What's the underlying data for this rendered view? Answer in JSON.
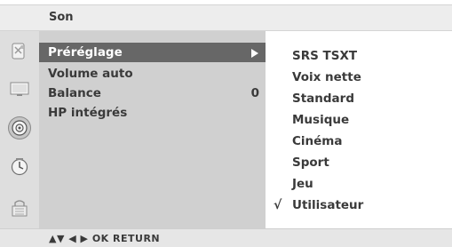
{
  "header": {
    "title": "Son"
  },
  "sidebar": {
    "icons": [
      {
        "name": "satellite-icon"
      },
      {
        "name": "monitor-icon"
      },
      {
        "name": "speaker-icon",
        "active": true
      },
      {
        "name": "clock-icon"
      },
      {
        "name": "lock-icon"
      }
    ]
  },
  "menu": {
    "items": [
      {
        "label": "Préréglage",
        "value": "",
        "selected": true
      },
      {
        "label": "Volume auto",
        "value": ""
      },
      {
        "label": "Balance",
        "value": "0"
      },
      {
        "label": "HP intégrés",
        "value": ""
      }
    ]
  },
  "options": {
    "items": [
      {
        "label": "SRS TSXT"
      },
      {
        "label": "Voix nette"
      },
      {
        "label": "Standard"
      },
      {
        "label": "Musique"
      },
      {
        "label": "Cinéma"
      },
      {
        "label": "Sport"
      },
      {
        "label": "Jeu"
      },
      {
        "label": "Utilisateur",
        "checked": true
      }
    ],
    "check_mark": "√"
  },
  "footer": {
    "nav_text": "▲▼  ◀ ▶  OK  RETURN"
  },
  "colors": {
    "menu_bg": "#d0d0d0",
    "selected_bg": "#676767",
    "icon_col_bg": "#dedede",
    "text": "#3a3a3a"
  }
}
